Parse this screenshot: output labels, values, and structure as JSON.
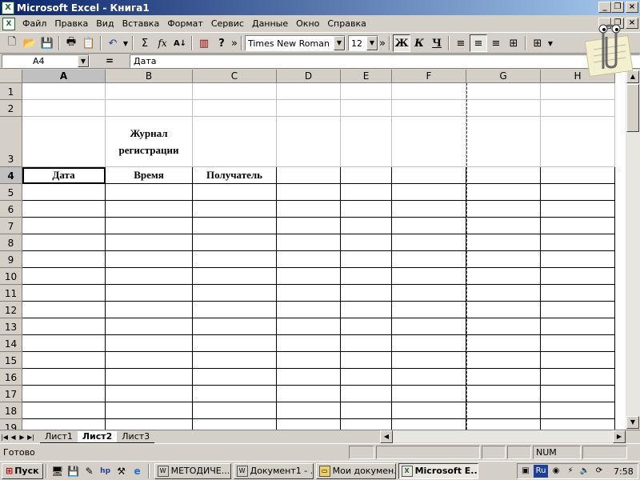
{
  "window": {
    "title": "Microsoft Excel - Книга1",
    "app_icon": "excel-icon"
  },
  "menu": [
    "Файл",
    "Правка",
    "Вид",
    "Вставка",
    "Формат",
    "Сервис",
    "Данные",
    "Окно",
    "Справка"
  ],
  "toolbar": {
    "font_name": "Times New Roman",
    "font_size": "12",
    "bold": "Ж",
    "italic": "К",
    "underline": "Ч",
    "sum": "Σ",
    "fx": "fx",
    "buttons": [
      "new-file-icon",
      "open-folder-icon",
      "save-icon",
      "print-icon",
      "paste-icon",
      "undo-icon",
      "autosum-icon",
      "function-icon",
      "sort-icon",
      "chart-wizard-icon",
      "help-icon",
      "align-left-icon",
      "align-center-icon",
      "align-right-icon",
      "merge-center-icon",
      "borders-icon"
    ]
  },
  "formula_bar": {
    "name_box": "A4",
    "equals": "=",
    "value": "Дата"
  },
  "grid": {
    "columns": [
      "A",
      "B",
      "C",
      "D",
      "E",
      "F",
      "G",
      "H"
    ],
    "rows": [
      "1",
      "2",
      "3",
      "4",
      "5",
      "6",
      "7",
      "8",
      "9",
      "10",
      "11",
      "12",
      "13",
      "14",
      "15",
      "16",
      "17",
      "18",
      "19"
    ],
    "cells": {
      "B3": "Журнал регистрации",
      "A4": "Дата",
      "B4": "Время",
      "C4": "Получатель"
    },
    "active_cell": "A4"
  },
  "sheets": {
    "tabs": [
      "Лист1",
      "Лист2",
      "Лист3"
    ],
    "active": "Лист2"
  },
  "status": {
    "text": "Готово",
    "num": "NUM"
  },
  "taskbar": {
    "start": "Пуск",
    "tasks": [
      {
        "label": "МЕТОДИЧЕ...",
        "icon": "word-icon"
      },
      {
        "label": "Документ1 - ...",
        "icon": "word-icon"
      },
      {
        "label": "Мои докумен...",
        "icon": "folder-icon"
      },
      {
        "label": "Microsoft E...",
        "icon": "excel-icon"
      }
    ],
    "lang": "Ru",
    "clock": "7:58"
  }
}
